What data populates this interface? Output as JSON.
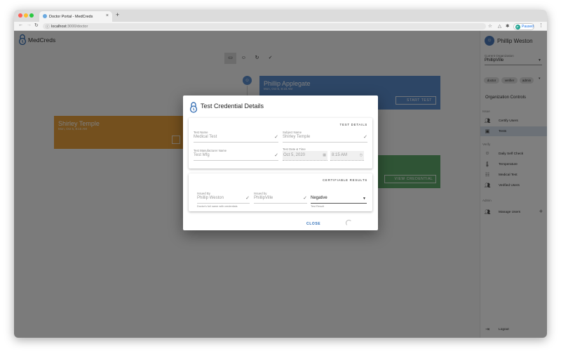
{
  "browser": {
    "tab_title": "Doctor Portal - MedCreds",
    "tab_close": "×",
    "new_tab": "+",
    "url_host": "localhost",
    "url_path": ":3000/doctor",
    "profile_initial": "P",
    "profile_status": "Paused"
  },
  "app": {
    "brand": "MedCreds",
    "toolbar_icons": [
      "id-card-icon",
      "person-check-icon",
      "refresh-icon",
      "check-icon"
    ]
  },
  "cards": {
    "blue": {
      "name": "Phillip Applegate",
      "date": "Mon, Oct 5, 8:15 AM",
      "button": "START TEST"
    },
    "orange": {
      "name": "Shirley Temple",
      "date": "Mon, Oct 5, 8:15 AM"
    },
    "green": {
      "button": "VIEW CREDENTIAL"
    }
  },
  "sidebar": {
    "user_name": "Phillip Weston",
    "org_label": "Current Organization",
    "org_value": "PhillipVille",
    "roles": [
      "doctor",
      "verifier",
      "admin"
    ],
    "org_controls": "Organization Controls",
    "sections": {
      "issue": "Issue",
      "verify": "Verify",
      "admin": "Admin"
    },
    "issue_items": [
      "Certify Users",
      "Tests"
    ],
    "verify_items": [
      "Daily Self Check",
      "Temperature",
      "Medical Test",
      "Verified Users"
    ],
    "admin_items": [
      "Manage Users"
    ],
    "logout": "Logout"
  },
  "dialog": {
    "title": "Test Credential Details",
    "test_details_header": "TEST DETAILS",
    "test_name_label": "Test Name",
    "test_name_value": "Medical Test",
    "subject_name_label": "Subject Name",
    "subject_name_value": "Shirley Temple",
    "manufacturer_label": "Test Manufacturer Name",
    "manufacturer_value": "Test Mfg",
    "datetime_label": "Test Date & Time",
    "date_value": "Oct 5, 2020",
    "time_value": "8:15 AM",
    "results_header": "CERTIFIABLE RESULTS",
    "issued_by_label": "Issued By",
    "issued_by_value": "Phillip Weston",
    "issued_by_help": "Doctor's full name with credentials",
    "issuer_org_label": "Issued by",
    "issuer_org_value": "PhillipVille",
    "result_value": "Negative",
    "result_help": "Test Result",
    "close_label": "CLOSE"
  },
  "colors": {
    "blue_card": "#5b8dcc",
    "orange_card": "#e8a13d",
    "green_card": "#5fa86a",
    "accent": "#2f6fb8",
    "selected_item": "#d8e3ef"
  }
}
